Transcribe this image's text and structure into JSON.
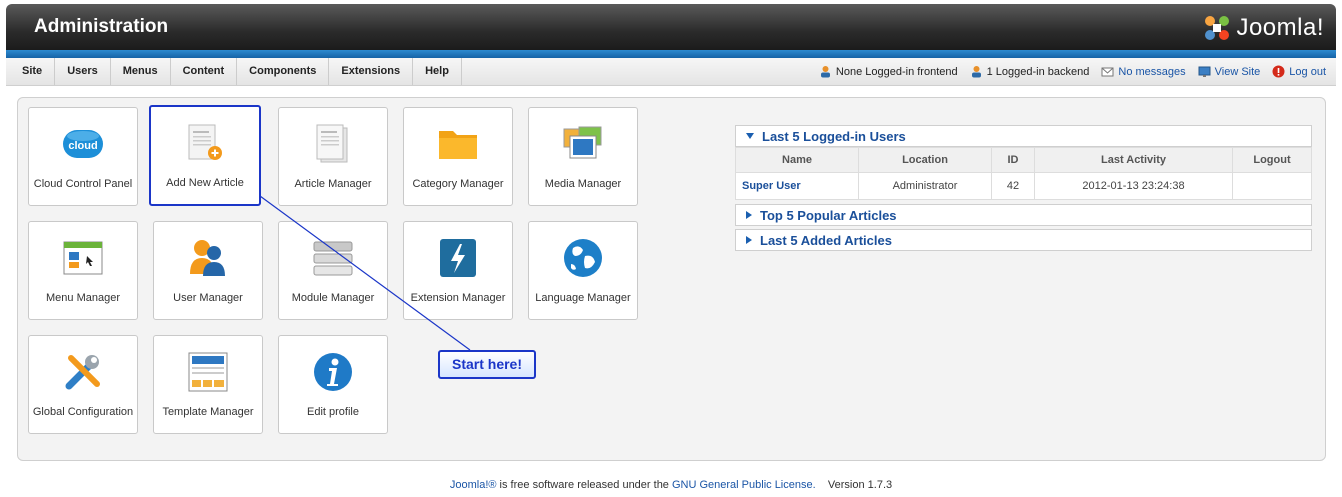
{
  "header": {
    "title": "Administration",
    "logo_text": "Joomla!"
  },
  "menu": [
    "Site",
    "Users",
    "Menus",
    "Content",
    "Components",
    "Extensions",
    "Help"
  ],
  "status": {
    "frontend": "None Logged-in frontend",
    "backend": "1 Logged-in backend",
    "messages": "No messages",
    "view_site": "View Site",
    "logout": "Log out"
  },
  "tiles": [
    {
      "label": "Cloud Control Panel",
      "icon": "cloud-icon"
    },
    {
      "label": "Add New Article",
      "icon": "add-article-icon"
    },
    {
      "label": "Article Manager",
      "icon": "article-icon"
    },
    {
      "label": "Category Manager",
      "icon": "folder-icon"
    },
    {
      "label": "Media Manager",
      "icon": "media-icon"
    },
    {
      "label": "Menu Manager",
      "icon": "menu-icon"
    },
    {
      "label": "User Manager",
      "icon": "users-icon"
    },
    {
      "label": "Module Manager",
      "icon": "module-icon"
    },
    {
      "label": "Extension Manager",
      "icon": "extension-icon"
    },
    {
      "label": "Language Manager",
      "icon": "globe-icon"
    },
    {
      "label": "Global Configuration",
      "icon": "tools-icon"
    },
    {
      "label": "Template Manager",
      "icon": "template-icon"
    },
    {
      "label": "Edit profile",
      "icon": "info-icon"
    }
  ],
  "callout": "Start here!",
  "modules": {
    "logged_in": {
      "title": "Last 5 Logged-in Users",
      "columns": [
        "Name",
        "Location",
        "ID",
        "Last Activity",
        "Logout"
      ],
      "rows": [
        [
          "Super User",
          "Administrator",
          "42",
          "2012-01-13 23:24:38",
          ""
        ]
      ]
    },
    "popular": {
      "title": "Top 5 Popular Articles"
    },
    "added": {
      "title": "Last 5 Added Articles"
    }
  },
  "footer": {
    "joomla": "Joomla!®",
    "text1": " is free software released under the ",
    "license": "GNU General Public License.",
    "version": "Version 1.7.3"
  },
  "colors": {
    "accent": "#1a55a6",
    "callout": "#1b36c8"
  }
}
